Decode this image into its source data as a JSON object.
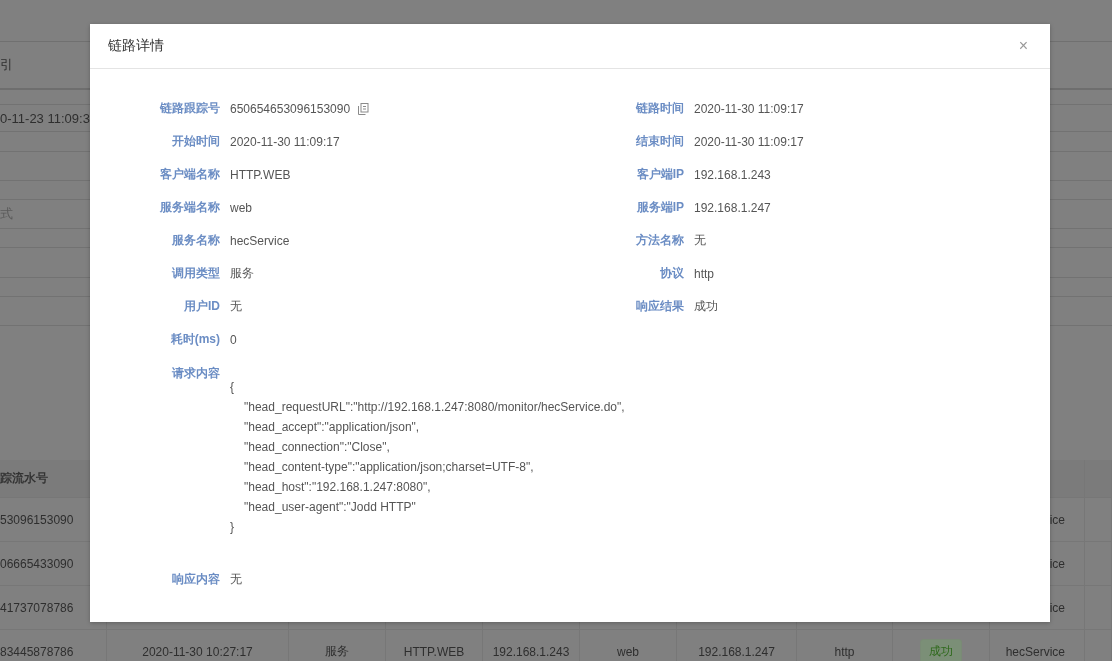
{
  "background": {
    "upper_table": {
      "header": "引",
      "row_time": "0-11-23 11:09:3",
      "row_field": "式"
    },
    "lower_table": {
      "header": "踪流水号",
      "rows": [
        {
          "serial": "53096153090",
          "service": "ice"
        },
        {
          "serial": "06665433090",
          "service": "ice"
        },
        {
          "serial": "41737078786",
          "service": "ice"
        },
        {
          "serial": "83445878786",
          "time": "2020-11-30 10:27:17",
          "type": "服务",
          "client": "HTTP.WEB",
          "client_ip": "192.168.1.243",
          "server": "web",
          "server_ip": "192.168.1.247",
          "protocol": "http",
          "result": "成功",
          "service": "hecService"
        }
      ]
    }
  },
  "dialog": {
    "title": "链路详情",
    "close": "×",
    "fields": [
      {
        "label": "链路跟踪号",
        "value": "650654653096153090",
        "copyable": true
      },
      {
        "label": "链路时间",
        "value": "2020-11-30 11:09:17",
        "copyable": false
      },
      {
        "label": "开始时间",
        "value": "2020-11-30 11:09:17",
        "copyable": false
      },
      {
        "label": "结束时间",
        "value": "2020-11-30 11:09:17",
        "copyable": false
      },
      {
        "label": "客户端名称",
        "value": "HTTP.WEB",
        "copyable": false
      },
      {
        "label": "客户端IP",
        "value": "192.168.1.243",
        "copyable": false
      },
      {
        "label": "服务端名称",
        "value": "web",
        "copyable": false
      },
      {
        "label": "服务端IP",
        "value": "192.168.1.247",
        "copyable": false
      },
      {
        "label": "服务名称",
        "value": "hecService",
        "copyable": false
      },
      {
        "label": "方法名称",
        "value": "无",
        "copyable": false
      },
      {
        "label": "调用类型",
        "value": "服务",
        "copyable": false
      },
      {
        "label": "协议",
        "value": "http",
        "copyable": false
      },
      {
        "label": "用户ID",
        "value": "无",
        "copyable": false
      },
      {
        "label": "响应结果",
        "value": "成功",
        "copyable": false
      },
      {
        "label": "耗时(ms)",
        "value": "0",
        "copyable": false
      }
    ],
    "request": {
      "label": "请求内容",
      "open": "{",
      "entries": [
        "\"head_requestURL\":\"http://192.168.1.247:8080/monitor/hecService.do\",",
        "\"head_accept\":\"application/json\",",
        "\"head_connection\":\"Close\",",
        "\"head_content-type\":\"application/json;charset=UTF-8\",",
        "\"head_host\":\"192.168.1.247:8080\",",
        "\"head_user-agent\":\"Jodd HTTP\""
      ],
      "close": "}"
    },
    "response": {
      "label": "响应内容",
      "value": "无"
    }
  }
}
